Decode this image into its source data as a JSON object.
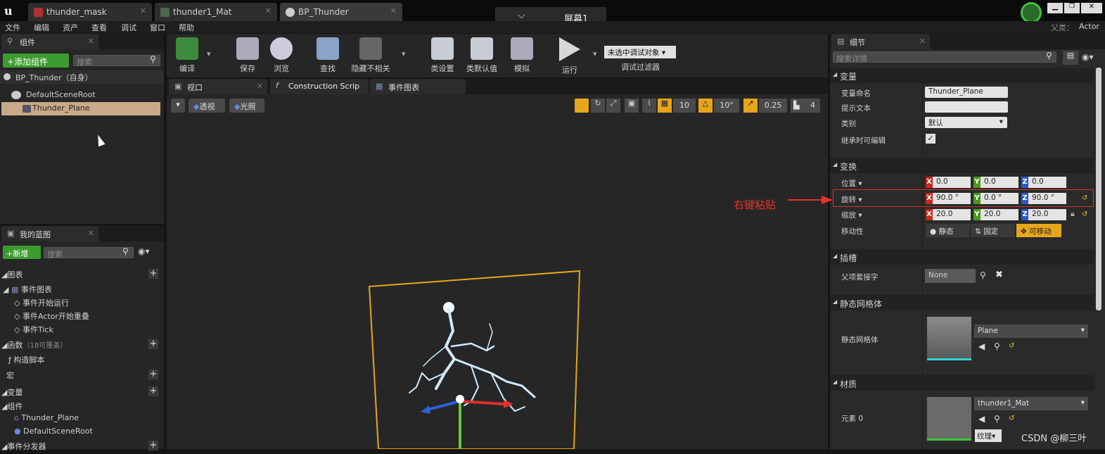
{
  "tabs": [
    {
      "label": "thunder_mask"
    },
    {
      "label": "thunder1_Mat"
    },
    {
      "label": "BP_Thunder"
    }
  ],
  "screen_label": "屏幕1",
  "parent": {
    "label": "父类：",
    "value": "Actor"
  },
  "menu": [
    "文件",
    "编辑",
    "资产",
    "查看",
    "调试",
    "窗口",
    "帮助"
  ],
  "toolbar": {
    "compile": "编译",
    "save": "保存",
    "browse": "浏览",
    "find": "查找",
    "hide_unrelated": "隐藏不相关",
    "class_settings": "类设置",
    "class_defaults": "类默认值",
    "simulate": "模拟",
    "play": "运行",
    "debug_object": "未选中调试对象",
    "debug_filter": "调试过滤器"
  },
  "components": {
    "title": "组件",
    "add_button": "+添加组件",
    "search_placeholder": "搜索",
    "self_item": "BP_Thunder（自身）",
    "root": "DefaultSceneRoot",
    "child": "Thunder_Plane"
  },
  "my_blueprint": {
    "title": "我的蓝图",
    "new_button": "+新增",
    "search_placeholder": "搜索",
    "graphs": "图表",
    "event_graph": "事件图表",
    "events": [
      "事件开始运行",
      "事件Actor开始重叠",
      "事件Tick"
    ],
    "functions": "函数",
    "functions_note": "（18可覆盖）",
    "construction": "构造脚本",
    "macros": "宏",
    "variables": "变量",
    "components_cat": "组件",
    "comp_items": [
      "Thunder_Plane",
      "DefaultSceneRoot"
    ],
    "dispatchers": "事件分发器"
  },
  "editor_tabs": {
    "viewport": "视口",
    "construction": "Construction Scrip",
    "event_graph": "事件图表"
  },
  "viewport": {
    "perspective": "透视",
    "lit": "光照",
    "grid_snap": "10",
    "rot_snap": "10°",
    "scale_snap": "0.25",
    "cam_speed": "4"
  },
  "details": {
    "title": "细节",
    "search_placeholder": "搜索详情",
    "sec_variable": "变量",
    "var_name_label": "变量命名",
    "var_name": "Thunder_Plane",
    "tooltip_label": "提示文本",
    "tooltip": "",
    "category_label": "类别",
    "category": "默认",
    "editable_label": "继承时可编辑",
    "sec_transform": "变换",
    "location_label": "位置",
    "location": [
      "0.0",
      "0.0",
      "0.0"
    ],
    "rotation_label": "旋转",
    "rotation": [
      "90.0 °",
      "0.0 °",
      "90.0 °"
    ],
    "scale_label": "缩放",
    "scale": [
      "20.0",
      "20.0",
      "20.0"
    ],
    "mobility_label": "移动性",
    "mobility": [
      "静态",
      "固定",
      "可移动"
    ],
    "sec_sockets": "插槽",
    "parent_socket_label": "父项套接字",
    "parent_socket": "None",
    "sec_mesh": "静态网格体",
    "mesh_label": "静态网格体",
    "mesh": "Plane",
    "sec_material": "材质",
    "element_label": "元素 0",
    "material": "thunder1_Mat",
    "texture": "纹理"
  },
  "annotation": "右键粘贴",
  "watermark": "CSDN @柳三叶",
  "colors": {
    "selected_row": "#c9a987",
    "annotation": "#e8332a",
    "gizmo_yellow": "#e6a51a",
    "movable": "#e6a51a"
  }
}
